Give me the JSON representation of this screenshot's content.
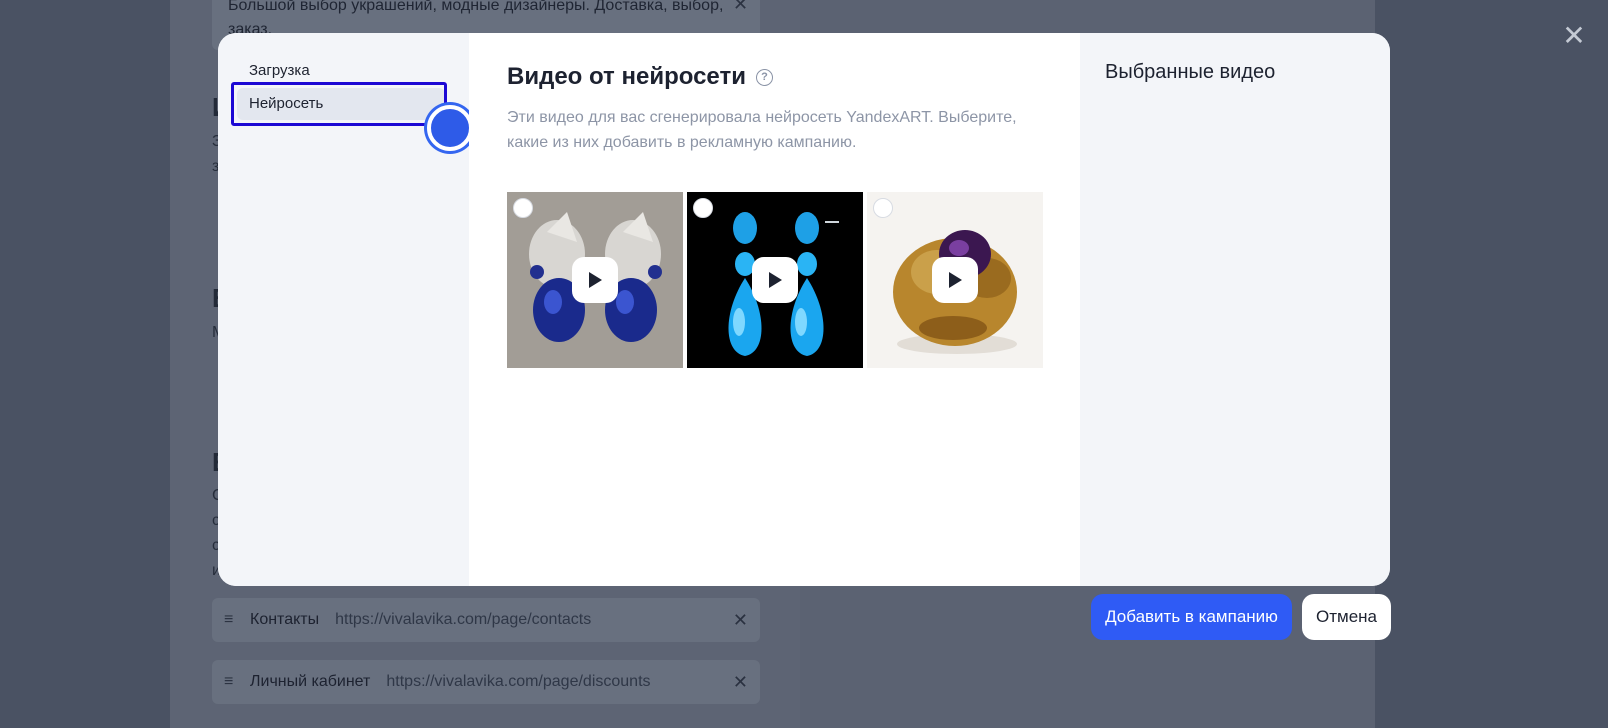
{
  "background": {
    "top_text": "Большой выбор украшений, модные дизайнеры. Доставка, выбор, заказ.",
    "links": [
      {
        "title": "Контакты",
        "url": "https://vivalavika.com/page/contacts"
      },
      {
        "title": "Личный кабинет",
        "url": "https://vivalavika.com/page/discounts"
      }
    ],
    "peek_letters": [
      "И",
      "В",
      "Е"
    ],
    "peek_small": [
      "З",
      "з",
      "М",
      "С",
      "с",
      "с",
      "и"
    ]
  },
  "modal": {
    "nav": {
      "items": [
        "Загрузка",
        "Нейросеть"
      ],
      "active_index": 1
    },
    "heading": "Видео от нейросети",
    "help_icon": "?",
    "description": "Эти видео для вас сгенерировала нейросеть YandexART. Выберите, какие из них добавить в рекламную кампанию.",
    "videos": [
      {
        "subject": "sapphire-earrings",
        "selected": false
      },
      {
        "subject": "blue-drop-earrings",
        "selected": false
      },
      {
        "subject": "amethyst-gold-ring",
        "selected": false
      }
    ],
    "selected_title": "Выбранные видео"
  },
  "buttons": {
    "add": "Добавить в кампанию",
    "cancel": "Отмена"
  },
  "overlay_close_icon": "✕",
  "colors": {
    "accent": "#2f5bf5",
    "focus": "#1c08d4"
  }
}
